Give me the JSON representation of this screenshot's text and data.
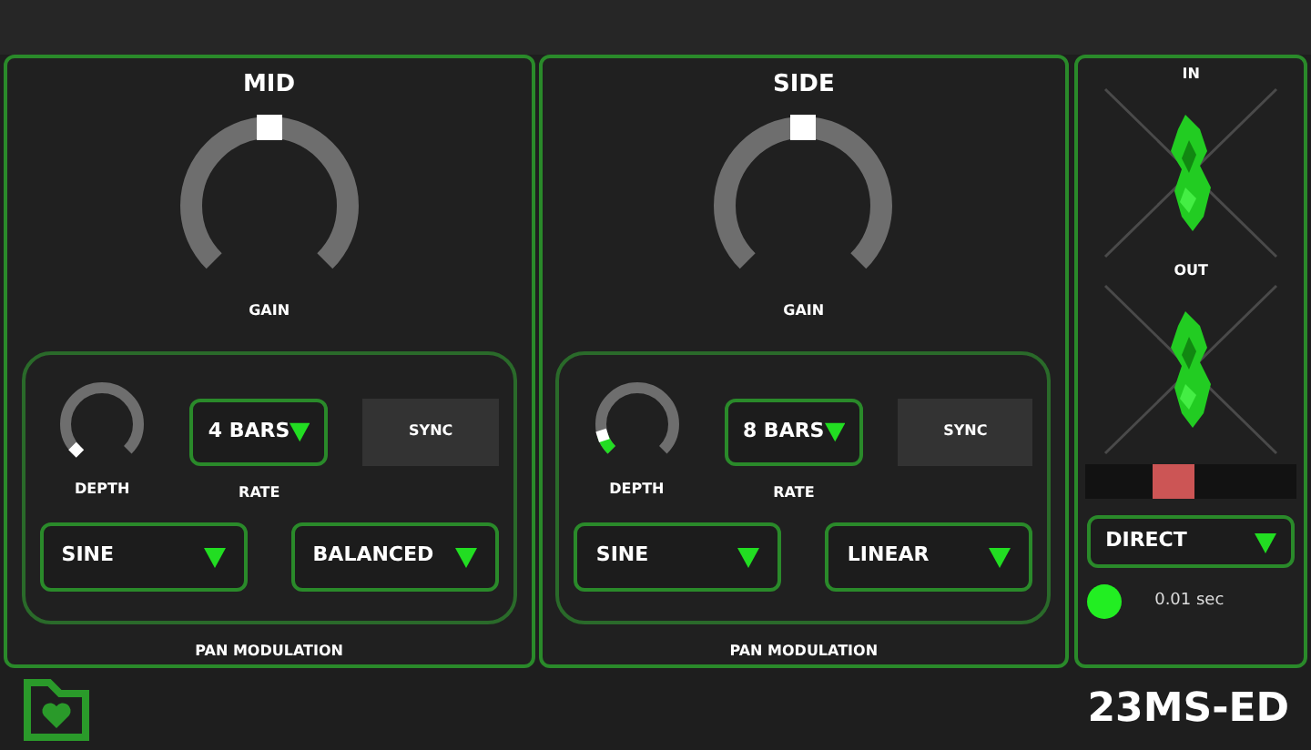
{
  "sections": [
    {
      "title": "MID",
      "gain": {
        "label": "GAIN",
        "level": 0.5
      },
      "pan_modulation": {
        "title": "PAN MODULATION",
        "depth": {
          "label": "DEPTH",
          "level": 0
        },
        "rate": {
          "label": "RATE",
          "value": "4 BARS"
        },
        "sync": {
          "label": "SYNC",
          "on": false
        },
        "shape": "SINE",
        "mode": "BALANCED"
      }
    },
    {
      "title": "SIDE",
      "gain": {
        "label": "GAIN",
        "level": 0.5
      },
      "pan_modulation": {
        "title": "PAN MODULATION",
        "depth": {
          "label": "DEPTH",
          "level": 0.1
        },
        "rate": {
          "label": "RATE",
          "value": "8 BARS"
        },
        "sync": {
          "label": "SYNC",
          "on": false
        },
        "shape": "SINE",
        "mode": "LINEAR"
      }
    }
  ],
  "scopes": [
    {
      "label": "IN"
    },
    {
      "label": "OUT"
    }
  ],
  "balance": {
    "level": 0.4
  },
  "routing": "DIRECT",
  "status": {
    "on": true,
    "time": "0.01 sec"
  },
  "footer": {
    "brand": "23MS-ED"
  }
}
